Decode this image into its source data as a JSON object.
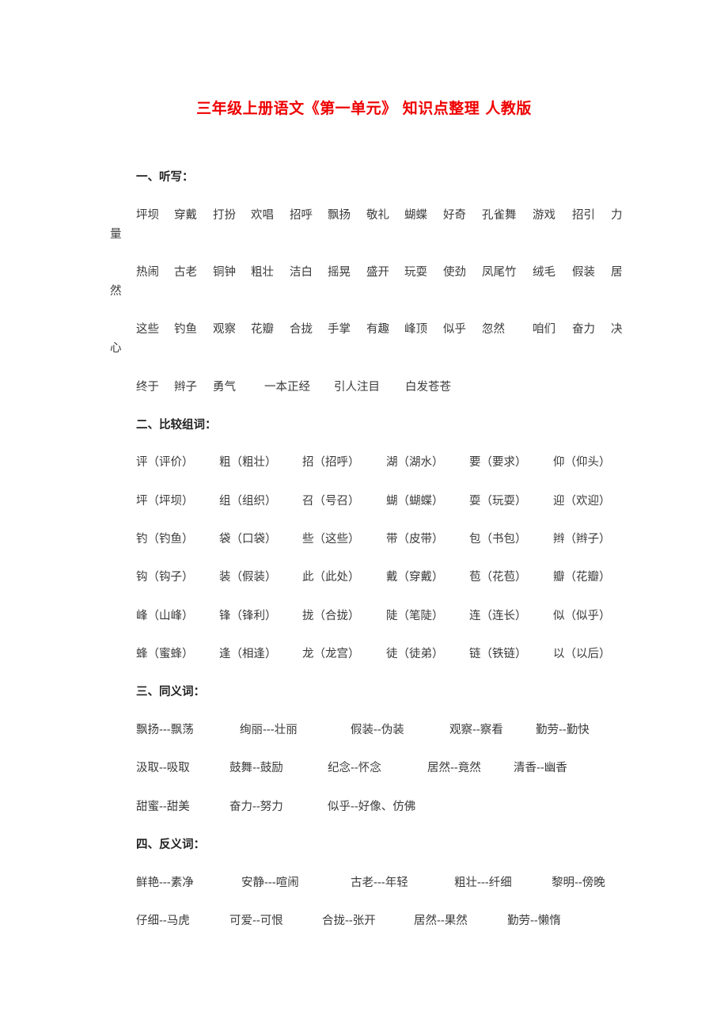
{
  "document": {
    "title": "三年级上册语文《第一单元》 知识点整理 人教版",
    "sections": [
      {
        "heading": "一、听写：",
        "lines": [
          {
            "words": [
              "坪坝",
              "穿戴",
              "打扮",
              "欢唱",
              "招呼",
              "飘扬",
              "敬礼",
              "蝴蝶",
              "好奇",
              "孔雀舞",
              "游戏",
              "招引",
              "力"
            ],
            "wrap": "量"
          },
          {
            "words": [
              "热闹",
              "古老",
              "铜钟",
              "粗壮",
              "洁白",
              "摇晃",
              "盛开",
              "玩耍",
              "使劲",
              "凤尾竹",
              "绒毛",
              "假装",
              "居"
            ],
            "wrap": "然"
          },
          {
            "words": [
              "这些",
              "钓鱼",
              "观察",
              "花瓣",
              "合拢",
              "手掌",
              "有趣",
              "峰顶",
              "似乎",
              "忽然",
              "咱们",
              "奋力",
              "决"
            ],
            "wrap": "心"
          },
          {
            "words": [
              "终于",
              "辫子",
              "勇气",
              "一本正经",
              "引人注目",
              "白发苍苍"
            ],
            "wrap": null
          }
        ]
      },
      {
        "heading": "二、比较组词：",
        "rows": [
          [
            "评（评价）",
            "粗（粗壮）",
            "招（招呼）",
            "湖（湖水）",
            "要（要求）",
            "仰（仰头）"
          ],
          [
            "坪（坪坝）",
            "组（组织）",
            "召（号召）",
            "蝴（蝴蝶）",
            "耍（玩耍）",
            "迎（欢迎）"
          ],
          [
            "钓（钓鱼）",
            "袋（口袋）",
            "些（这些）",
            "带（皮带）",
            "包（书包）",
            "辫（辫子）"
          ],
          [
            "钩（钩子）",
            "装（假装）",
            "此（此处）",
            "戴（穿戴）",
            "苞（花苞）",
            "瓣（花瓣）"
          ],
          [
            "峰（山峰）",
            "锋（锋利）",
            "拢（合拢）",
            "陡（笔陡）",
            "连（连长）",
            "似（似乎）"
          ],
          [
            "蜂（蜜蜂）",
            "逢（相逢）",
            "龙（龙宫）",
            "徒（徒弟）",
            "链（铁链）",
            "以（以后）"
          ]
        ]
      },
      {
        "heading": "三、同义词：",
        "rows": [
          [
            "飘扬---飘荡",
            "绚丽---壮丽",
            "假装--伪装",
            "观察--察看",
            "勤劳--勤快"
          ],
          [
            "汲取--吸取",
            "鼓舞--鼓励",
            "纪念--怀念",
            "居然--竟然",
            "清香--幽香"
          ],
          [
            "甜蜜--甜美",
            "奋力--努力",
            "似乎--好像、仿佛"
          ]
        ]
      },
      {
        "heading": "四、反义词：",
        "rows": [
          [
            "鲜艳---素净",
            "安静---喧闹",
            "古老---年轻",
            "粗壮---纤细",
            "黎明--傍晚"
          ],
          [
            "仔细--马虎",
            "可爱--可恨",
            "合拢--张开",
            "居然--果然",
            "勤劳--懒惰"
          ]
        ]
      }
    ]
  },
  "colors": {
    "title": "#ee0000",
    "text": "#3a3a3a"
  }
}
